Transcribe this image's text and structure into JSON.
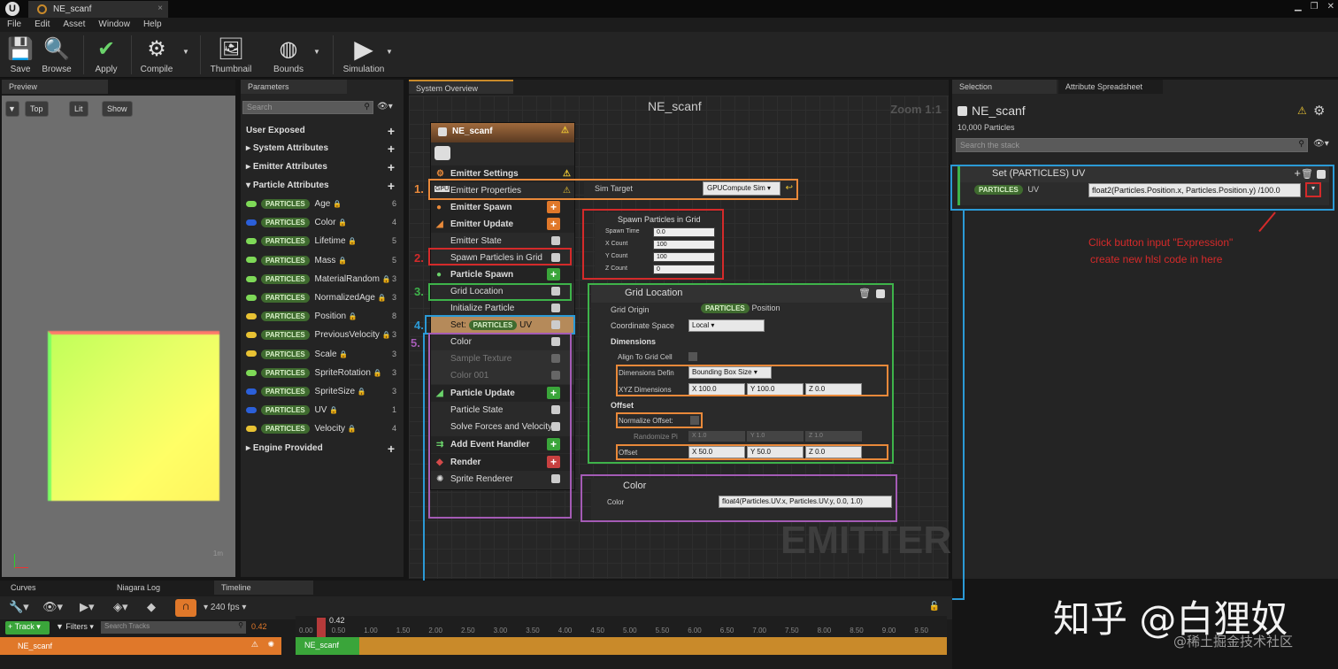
{
  "window": {
    "tab_title": "NE_scanf"
  },
  "menu": [
    "File",
    "Edit",
    "Asset",
    "Window",
    "Help"
  ],
  "toolbar": {
    "save": "Save",
    "browse": "Browse",
    "apply": "Apply",
    "compile": "Compile",
    "thumbnail": "Thumbnail",
    "bounds": "Bounds",
    "simulation": "Simulation"
  },
  "preview": {
    "tab": "Preview",
    "view_top": "Top",
    "view_lit": "Lit",
    "view_show": "Show",
    "scale": "1m"
  },
  "parameters": {
    "tab": "Parameters",
    "search_placeholder": "Search",
    "user_exposed": "User Exposed",
    "system_attributes": "System Attributes",
    "emitter_attributes": "Emitter Attributes",
    "particle_attributes": "Particle Attributes",
    "engine_provided": "Engine Provided",
    "particles_tag": "PARTICLES",
    "items": [
      {
        "name": "Age",
        "count": "6",
        "color": "#7ed957"
      },
      {
        "name": "Color",
        "count": "4",
        "color": "#2b5fd9"
      },
      {
        "name": "Lifetime",
        "count": "5",
        "color": "#7ed957"
      },
      {
        "name": "Mass",
        "count": "5",
        "color": "#7ed957"
      },
      {
        "name": "MaterialRandom",
        "count": "3",
        "color": "#7ed957"
      },
      {
        "name": "NormalizedAge",
        "count": "3",
        "color": "#7ed957"
      },
      {
        "name": "Position",
        "count": "8",
        "color": "#e8c233"
      },
      {
        "name": "PreviousVelocity",
        "count": "3",
        "color": "#e8c233"
      },
      {
        "name": "Scale",
        "count": "3",
        "color": "#e8c233"
      },
      {
        "name": "SpriteRotation",
        "count": "3",
        "color": "#7ed957"
      },
      {
        "name": "SpriteSize",
        "count": "3",
        "color": "#2b5fd9"
      },
      {
        "name": "UV",
        "count": "1",
        "color": "#2b5fd9"
      },
      {
        "name": "Velocity",
        "count": "4",
        "color": "#e8c233"
      }
    ]
  },
  "overview": {
    "tab": "System Overview",
    "title": "NE_scanf",
    "zoom": "Zoom 1:1",
    "watermark": "EMITTER",
    "node_title": "NE_scanf",
    "rows": {
      "emitter_settings": "Emitter Settings",
      "emitter_properties": "Emitter Properties",
      "emitter_spawn": "Emitter Spawn",
      "emitter_update": "Emitter Update",
      "emitter_state": "Emitter State",
      "spawn_particles_in_grid": "Spawn Particles in Grid",
      "particle_spawn": "Particle Spawn",
      "grid_location": "Grid Location",
      "initialize_particle": "Initialize Particle",
      "set_prefix": "Set:",
      "set_tag": "PARTICLES",
      "set_suffix": "UV",
      "color": "Color",
      "sample_texture": "Sample Texture",
      "color001": "Color 001",
      "particle_update": "Particle Update",
      "particle_state": "Particle State",
      "solve_forces": "Solve Forces and Velocity",
      "add_event_handler": "Add Event Handler",
      "render": "Render",
      "sprite_renderer": "Sprite Renderer"
    },
    "markers": [
      "1.",
      "2.",
      "3.",
      "4.",
      "5."
    ],
    "sim_target": {
      "label": "Sim Target",
      "value": "GPUCompute Sim"
    },
    "spawn_grid": {
      "title": "Spawn Particles in Grid",
      "rows": [
        {
          "label": "Spawn Time",
          "value": "0.0"
        },
        {
          "label": "X Count",
          "value": "100"
        },
        {
          "label": "Y Count",
          "value": "100"
        },
        {
          "label": "Z Count",
          "value": "0"
        }
      ]
    },
    "grid_loc": {
      "title": "Grid Location",
      "grid_origin": "Grid Origin",
      "origin_tag": "PARTICLES",
      "origin_value": "Position",
      "coord_space": "Coordinate Space",
      "coord_value": "Local",
      "dimensions": "Dimensions",
      "align": "Align To Grid Cell",
      "dim_def": "Dimensions Defin",
      "dim_def_value": "Bounding Box Size",
      "xyz": "XYZ Dimensions",
      "xyz_x": "X 100.0",
      "xyz_y": "Y 100.0",
      "xyz_z": "Z 0.0",
      "offset_section": "Offset",
      "normalize": "Normalize Offset:",
      "randomize": "Randomize Pi",
      "rand_x": "X 1.0",
      "rand_y": "Y 1.0",
      "rand_z": "Z 1.0",
      "offset": "Offset",
      "off_x": "X 50.0",
      "off_y": "Y 50.0",
      "off_z": "Z 0.0"
    },
    "color_node": {
      "title": "Color",
      "label": "Color",
      "expr": "float4(Particles.UV.x, Particles.UV.y, 0.0, 1.0)"
    }
  },
  "selection": {
    "tab": "Selection",
    "tab2": "Attribute Spreadsheet",
    "title": "NE_scanf",
    "particles": "10,000 Particles",
    "search_placeholder": "Search the stack",
    "set_title": "Set (PARTICLES) UV",
    "tag": "PARTICLES",
    "uv": "UV",
    "expr": "float2(Particles.Position.x, Particles.Position.y) /100.0",
    "note1": "Click button input \"Expression\"",
    "note2": "create new hlsl code in here"
  },
  "bottom": {
    "tabs": [
      "Curves",
      "Niagara Log",
      "Timeline"
    ],
    "fps": "240 fps",
    "track": "Track",
    "filters": "Filters",
    "search_tracks": "Search Tracks",
    "time": "0.42",
    "track_name": "NE_scanf",
    "clip": "NE_scanf",
    "ticks": [
      "0.00",
      "0.50",
      "1.00",
      "1.50",
      "2.00",
      "2.50",
      "3.00",
      "3.50",
      "4.00",
      "4.50",
      "5.00",
      "5.50",
      "6.00",
      "6.50",
      "7.00",
      "7.50",
      "8.00",
      "8.50",
      "9.00",
      "9.50"
    ],
    "marker_time": "0.42"
  },
  "watermark": {
    "main": "知乎 @白狸奴",
    "sub": "@稀土掘金技术社区"
  },
  "colors": {
    "orange": "#e9893a",
    "red": "#d42a2a",
    "green": "#3eb34a",
    "blue": "#2b9ad6",
    "purple": "#a45bb5"
  }
}
